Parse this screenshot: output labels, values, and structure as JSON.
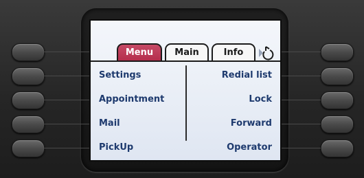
{
  "tabs": [
    {
      "label": "Menu",
      "active": true
    },
    {
      "label": "Main",
      "active": false
    },
    {
      "label": "Info",
      "active": false
    }
  ],
  "left_items": [
    "Settings",
    "Appointment",
    "Mail",
    "PickUp"
  ],
  "right_items": [
    "Redial list",
    "Lock",
    "Forward",
    "Operator"
  ],
  "icons": {
    "tab_scroll": "scroll-right-arrow-icon"
  },
  "colors": {
    "active_tab": "#b52e4c",
    "menu_text": "#1e3a6e",
    "screen_bg": "#e8edf5",
    "housing": "#2b2b2b"
  }
}
